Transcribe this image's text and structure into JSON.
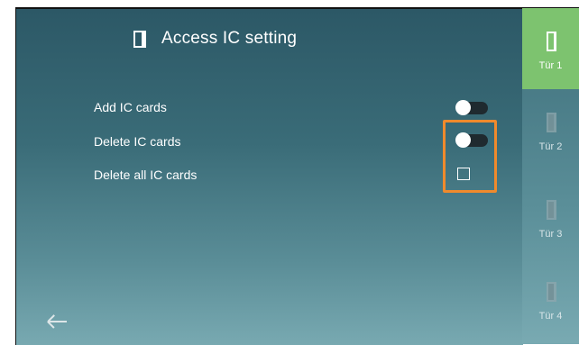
{
  "header": {
    "title": "Access IC setting"
  },
  "settings": [
    {
      "label": "Add IC cards",
      "control": "toggle",
      "state": "off"
    },
    {
      "label": "Delete IC cards",
      "control": "toggle",
      "state": "off"
    },
    {
      "label": "Delete all IC cards",
      "control": "checkbox",
      "state": "unchecked"
    }
  ],
  "sidebar": {
    "tabs": [
      {
        "label": "Tür 1",
        "active": true
      },
      {
        "label": "Tür 2",
        "active": false
      },
      {
        "label": "Tür 3",
        "active": false
      },
      {
        "label": "Tür 4",
        "active": false
      }
    ]
  },
  "colors": {
    "accent": "#7dc36f",
    "highlight": "#f08a2c",
    "panel": "#2c5866"
  },
  "icons": {
    "header": "door-icon",
    "back": "back-arrow-icon",
    "tabs": "door-icon"
  }
}
